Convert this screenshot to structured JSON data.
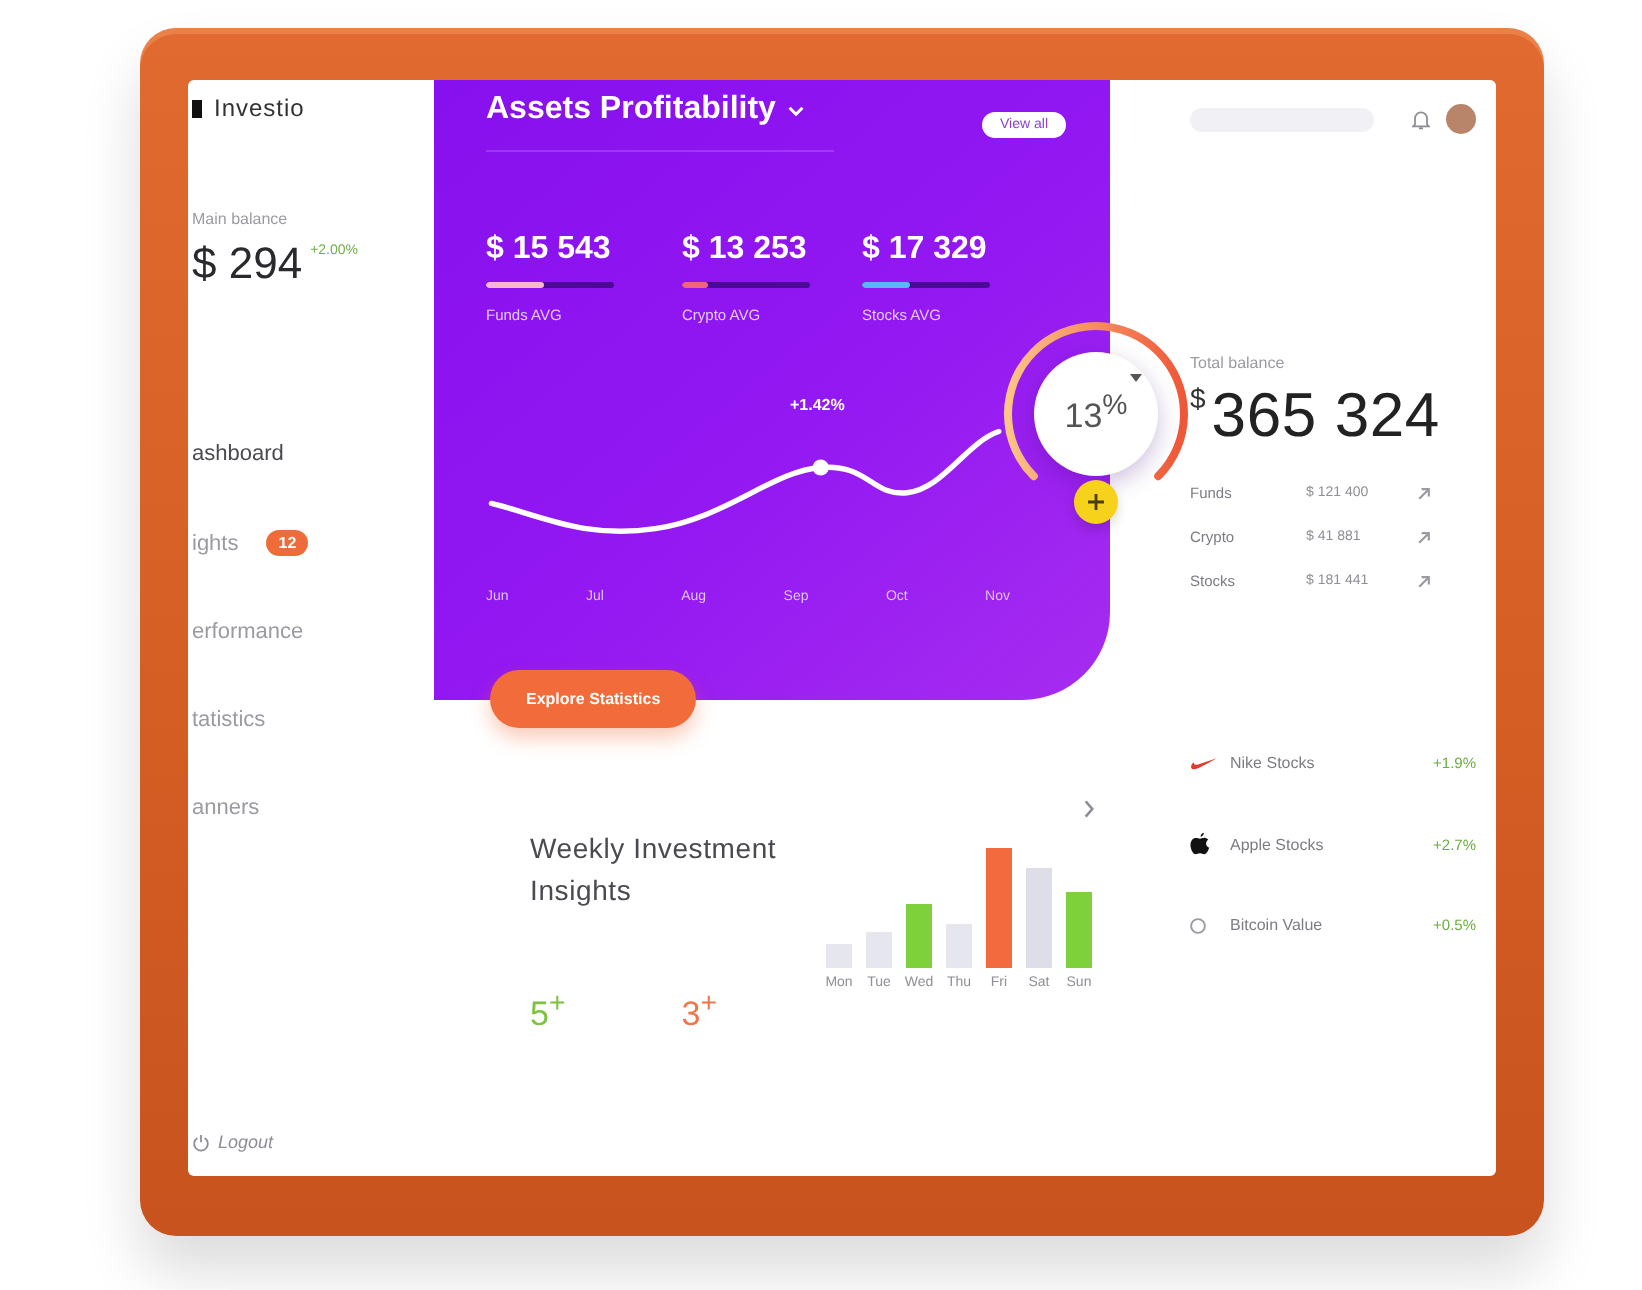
{
  "sidebar": {
    "logo": "Investio",
    "balance": {
      "label": "Main balance",
      "amount": "$ 294",
      "change": "+2.00%"
    },
    "nav": [
      {
        "label": "ashboard",
        "selected": true
      },
      {
        "label": "ights",
        "selected": false,
        "badge": "12"
      },
      {
        "label": "erformance",
        "selected": false
      },
      {
        "label": "tatistics",
        "selected": false
      },
      {
        "label": "anners",
        "selected": false
      }
    ],
    "logout": "Logout"
  },
  "profitability": {
    "title": "Assets Profitability",
    "view_all": "View all",
    "stats": [
      {
        "value": "$ 15 543",
        "label": "Funds AVG",
        "level": 0.45,
        "color": "#f8b6cf"
      },
      {
        "value": "$ 13 253",
        "label": "Crypto AVG",
        "level": 0.2,
        "color": "#f2647c"
      },
      {
        "value": "$ 17 329",
        "label": "Stocks AVG",
        "level": 0.38,
        "color": "#5cb6f2"
      }
    ],
    "trend": {
      "months": [
        "Jun",
        "Jul",
        "Aug",
        "Sep",
        "Oct",
        "Nov"
      ],
      "highlight": "+1.42%"
    },
    "button": "Explore Statistics"
  },
  "gauge": {
    "value": "13$^{%}$"
  },
  "account": {
    "total_label": "Total balance",
    "currency": "$",
    "total": "365 324",
    "rows": [
      {
        "name": "Funds",
        "amount": "$ 121 400"
      },
      {
        "name": "Crypto",
        "amount": "$ 41 881"
      },
      {
        "name": "Stocks",
        "amount": "$ 181 441"
      }
    ]
  },
  "weekly": {
    "title": "Weekly Investment Insights",
    "counts": [
      {
        "value": "5$^{+}$",
        "color": "#7fc241"
      },
      {
        "value": "3$^{+}$",
        "color": "#f0764a"
      }
    ],
    "days": [
      "Mon",
      "Tue",
      "Wed",
      "Thu",
      "Fri",
      "Sat",
      "Sun"
    ]
  },
  "stocks": [
    {
      "kind": "swoosh",
      "name": "Nike Stocks",
      "change": "+1.9%"
    },
    {
      "kind": "apple",
      "name": "Apple Stocks",
      "change": "+2.7%"
    },
    {
      "kind": "coin",
      "name": "Bitcoin Value",
      "change": "+0.5%"
    }
  ]
}
